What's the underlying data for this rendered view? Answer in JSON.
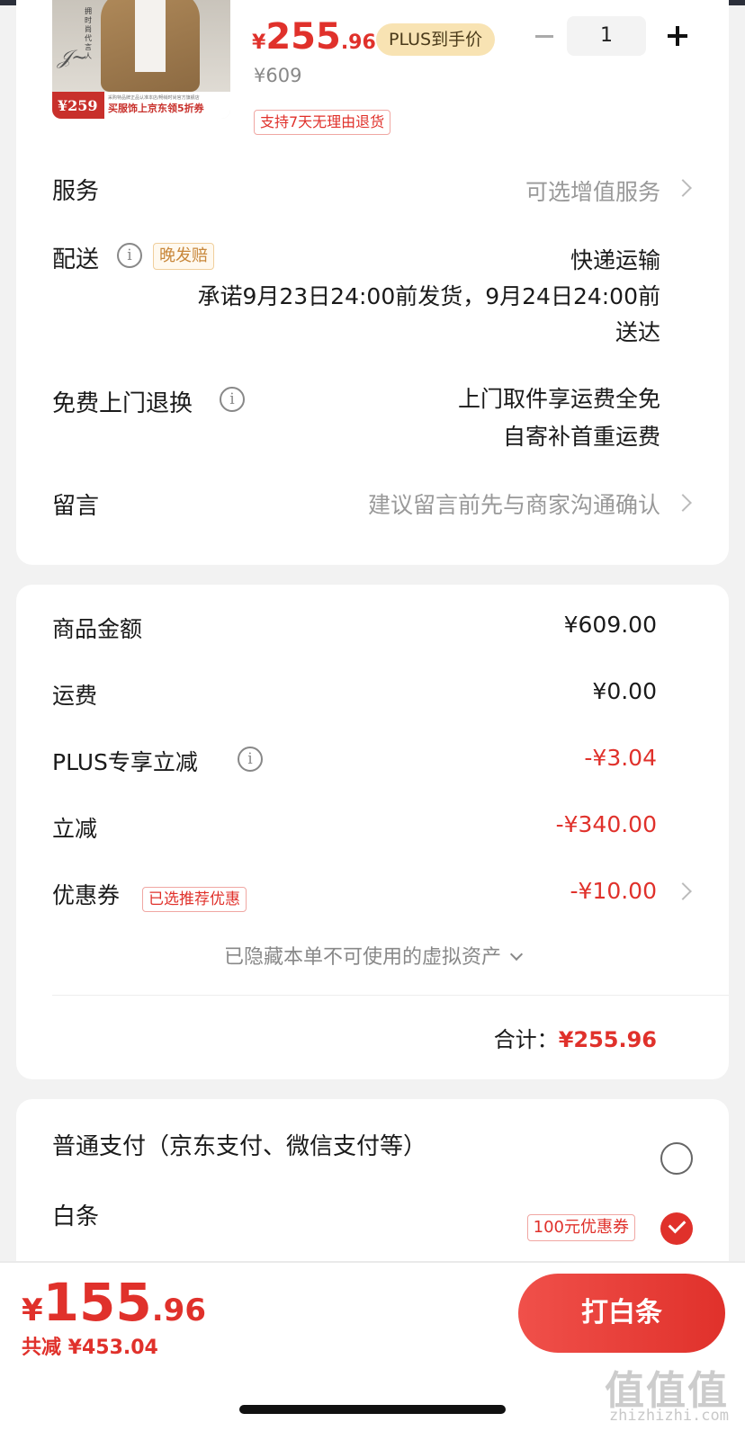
{
  "product": {
    "thumb_vertical_text": "拥时尚代言人",
    "thumb_small_text": "采购特品牌正品认准本店/畅销时尚官方旗舰店",
    "thumb_price": "259",
    "thumb_promo": "买服饰上京东领5折券",
    "price_symbol": "¥",
    "price_int": "255",
    "price_dec": ".96",
    "plus_tag": "PLUS到手价",
    "original_price": "¥609",
    "return_tag": "支持7天无理由退货",
    "quantity": "1"
  },
  "service": {
    "label": "服务",
    "value": "可选增值服务"
  },
  "delivery": {
    "label": "配送",
    "late_tag": "晚发赔",
    "method": "快递运输",
    "promise_line1": "承诺9月23日24:00前发货，9月24日24:00前",
    "promise_line2": "送达"
  },
  "free_return": {
    "label": "免费上门退换",
    "line1": "上门取件享运费全免",
    "line2": "自寄补首重运费"
  },
  "message": {
    "label": "留言",
    "placeholder": "建议留言前先与商家沟通确认"
  },
  "amounts": {
    "goods_label": "商品金额",
    "goods_value": "¥609.00",
    "shipping_label": "运费",
    "shipping_value": "¥0.00",
    "plus_label": "PLUS专享立减",
    "plus_value": "-¥3.04",
    "discount_label": "立减",
    "discount_value": "-¥340.00",
    "coupon_label": "优惠券",
    "coupon_tag": "已选推荐优惠",
    "coupon_value": "-¥10.00",
    "hidden_assets": "已隐藏本单不可使用的虚拟资产",
    "total_label": "合计：",
    "total_value": "¥255.96"
  },
  "payment": {
    "normal_label": "普通支付（京东支付、微信支付等）",
    "baitiao_label": "白条",
    "baitiao_coupon": "100元优惠券"
  },
  "bottom": {
    "price_symbol": "¥",
    "price_int": "155",
    "price_dec": ".96",
    "total_discount": "共减 ¥453.04",
    "pay_button": "打白条",
    "watermark": "值值值",
    "watermark_url": "zhizhizhi.com"
  },
  "colors": {
    "accent": "#e0312b",
    "plus_tag_bg": "#f8e3b3",
    "late_tag": "#c8873a"
  },
  "icons": [
    "info-icon",
    "chevron-right-icon",
    "chevron-down-icon",
    "radio-icon",
    "check-icon",
    "minus-icon",
    "plus-icon"
  ]
}
